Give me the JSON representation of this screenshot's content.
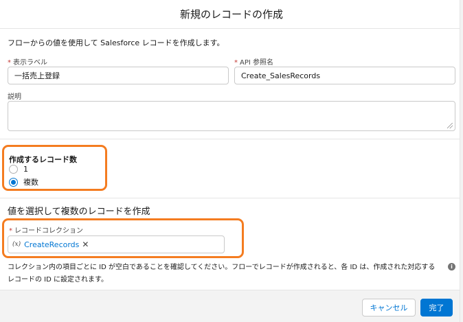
{
  "modal": {
    "title": "新規のレコードの作成",
    "intro": "フローからの値を使用して Salesforce レコードを作成します。"
  },
  "fields": {
    "label": {
      "required_mark": "*",
      "label": "表示ラベル",
      "value": "一括売上登録"
    },
    "api_name": {
      "required_mark": "*",
      "label": "API 参照名",
      "value": "Create_SalesRecords"
    },
    "description": {
      "label": "説明",
      "value": ""
    }
  },
  "record_count": {
    "title": "作成するレコード数",
    "options": [
      {
        "label": "1",
        "selected": false
      },
      {
        "label": "複数",
        "selected": true
      }
    ]
  },
  "multiple_section": {
    "heading": "値を選択して複数のレコードを作成",
    "collection_label": "レコードコレクション",
    "required_mark": "*",
    "variable_icon": "(x)",
    "selected_value": "CreateRecords",
    "remove_icon": "✕"
  },
  "note": "コレクション内の項目ごとに ID が空白であることを確認してください。フローでレコードが作成されると、各 ID は、作成された対応するレコードの ID に設定されます。",
  "info_icon": "i",
  "footer": {
    "cancel_label": "キャンセル",
    "done_label": "完了"
  },
  "colors": {
    "highlight": "#f47c20",
    "brand": "#0176d3",
    "required": "#c23934"
  }
}
